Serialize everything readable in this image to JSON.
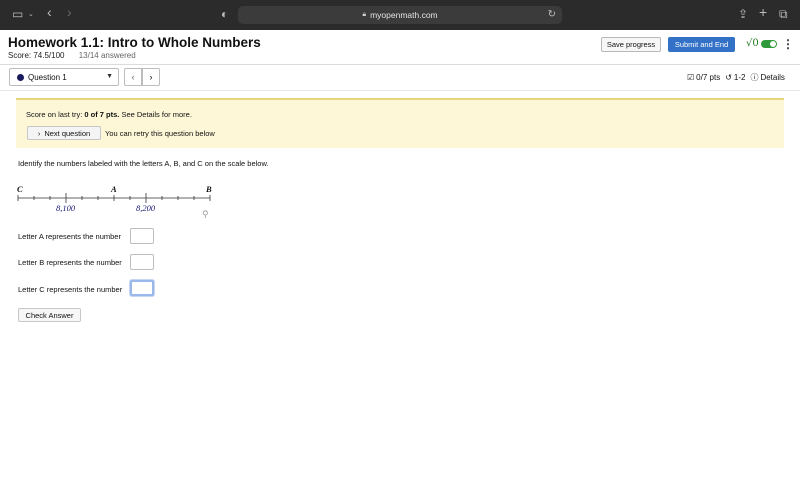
{
  "browser": {
    "url": "myopenmath.com"
  },
  "header": {
    "title": "Homework 1.1: Intro to Whole Numbers",
    "score": "Score: 74.5/100",
    "answered": "13/14 answered",
    "save_label": "Save progress",
    "submit_label": "Submit and End",
    "math_toggle_label": "√0",
    "menu_icon": "⋮"
  },
  "question_nav": {
    "selected": "Question 1",
    "prev_glyph": "‹",
    "next_glyph": "›",
    "points": "0/7 pts",
    "attempts": "1-2",
    "details": "Details"
  },
  "notice": {
    "last_try_prefix": "Score on last try: ",
    "last_try_score": "0 of 7 pts.",
    "last_try_suffix": " See Details for more.",
    "next_question_label": "Next question",
    "retry_text": "You can retry this question below"
  },
  "question": {
    "prompt": "Identify the numbers labeled with the letters A, B, and C on the scale below.",
    "number_line": {
      "letters": [
        "C",
        "A",
        "B"
      ],
      "tick_values": [
        "8,100",
        "8,200"
      ]
    },
    "answers": [
      {
        "label": "Letter A represents the number",
        "value": ""
      },
      {
        "label": "Letter B represents the number",
        "value": ""
      },
      {
        "label": "Letter C represents the number",
        "value": ""
      }
    ],
    "check_label": "Check Answer"
  },
  "colors": {
    "submit_button": "#3271c6",
    "notice_bg": "#fdf7d8",
    "toggle_on": "#2e9a3a"
  }
}
